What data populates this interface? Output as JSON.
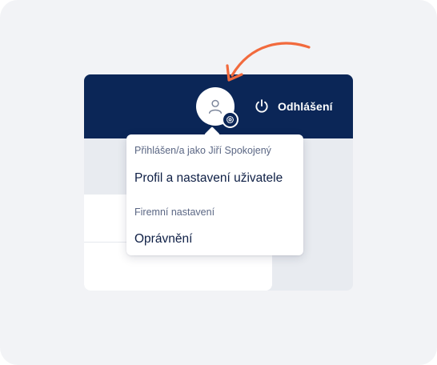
{
  "header": {
    "logout_label": "Odhlášení",
    "logout_icon": "power-icon"
  },
  "user_menu": {
    "avatar_icon": "user-icon",
    "badge_icon": "gear-icon",
    "signed_in_label": "Přihlášen/a jako Jiří Spokojený",
    "profile_link": "Profil a nastavení uživatele",
    "company_settings_label": "Firemní nastavení",
    "permissions_link": "Oprávnění"
  },
  "annotation": {
    "arrow_color": "#f26a3d",
    "arrow_icon": "curved-arrow"
  },
  "colors": {
    "topbar": "#0b2657",
    "background": "#f2f3f6"
  }
}
